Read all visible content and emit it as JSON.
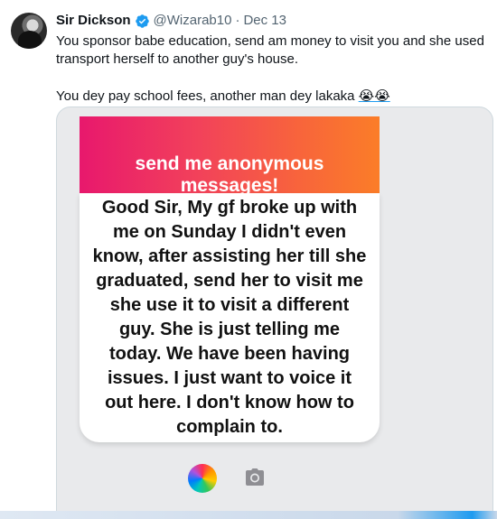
{
  "tweet": {
    "name": "Sir Dickson",
    "handle": "@Wizarab10",
    "separator": "·",
    "date": "Dec 13",
    "text_line1": "You sponsor babe education, send am money to visit you and she used transport herself to another guy's house.",
    "text_line2": "You dey pay school fees, another man dey lakaka",
    "emojis": "😭😭"
  },
  "image": {
    "header": "send me anonymous messages!",
    "message": "Good Sir, My gf broke up with me on Sunday I didn't even know, after assisting her till she graduated, send her to visit me she use it to visit a different guy. She is just telling me today. We have been having issues. I just want to voice it out here. I don't know how to complain to."
  },
  "colors": {
    "accent": "#1d9bf0",
    "gradient_start": "#e8186d",
    "gradient_end": "#fb7d28"
  },
  "icons": [
    "verified-badge-icon",
    "color-wheel-icon",
    "camera-icon"
  ]
}
